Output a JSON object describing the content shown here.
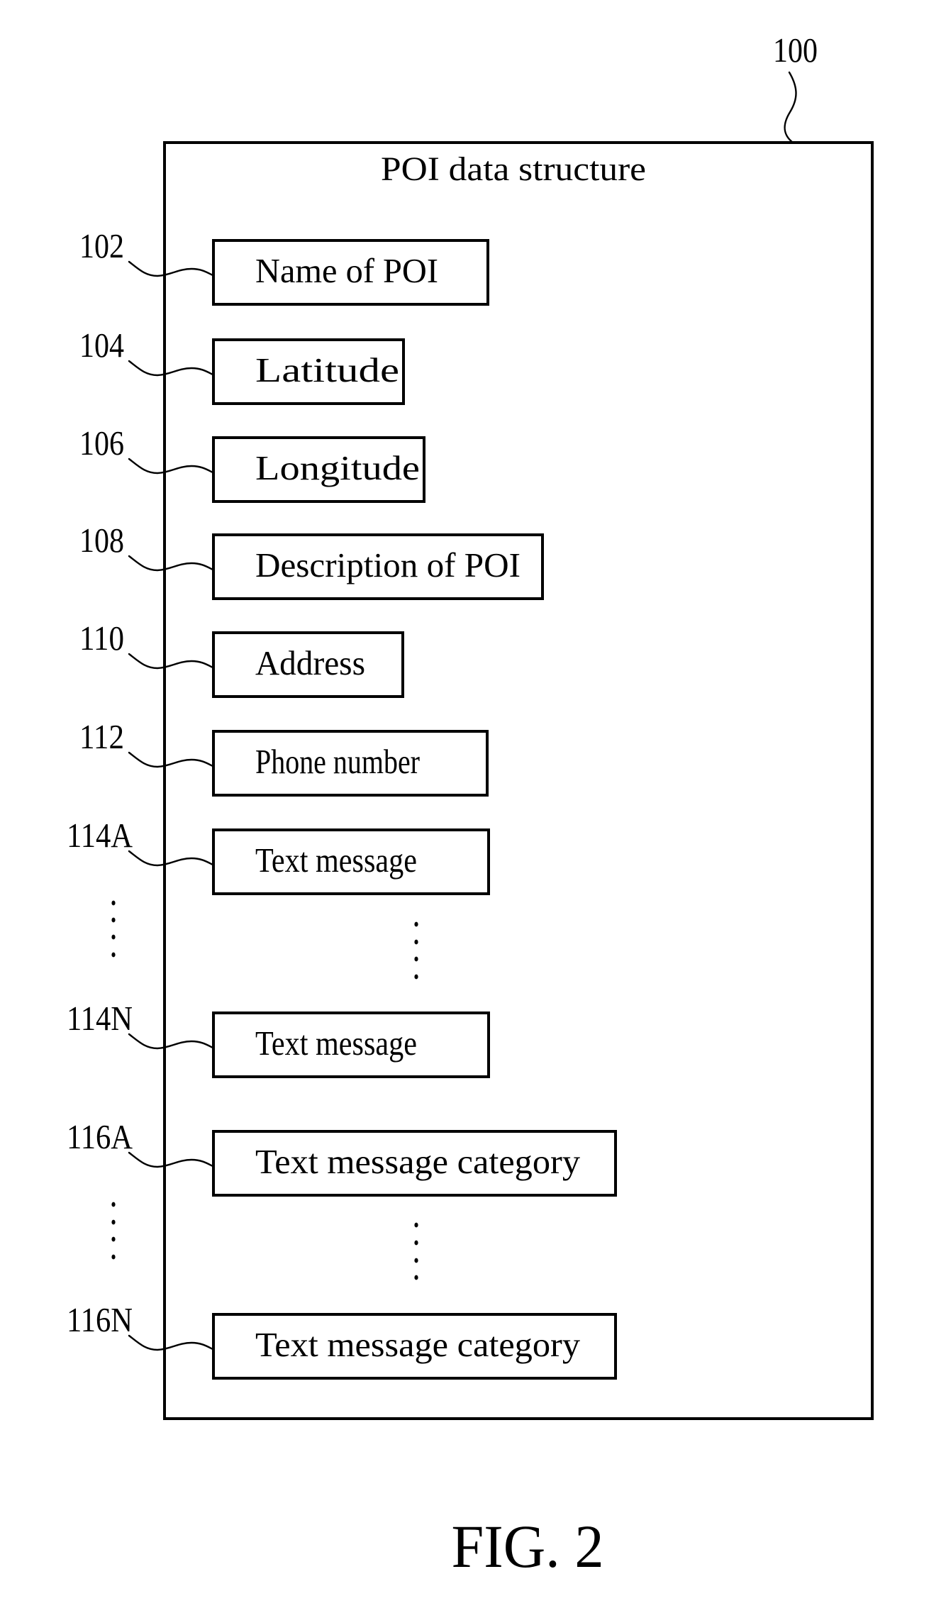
{
  "figure": {
    "caption": "FIG. 2",
    "container": {
      "ref": "100",
      "title": "POI data structure"
    },
    "fields": [
      {
        "ref": "102",
        "label": "Name of POI"
      },
      {
        "ref": "104",
        "label": "Latitude"
      },
      {
        "ref": "106",
        "label": "Longitude"
      },
      {
        "ref": "108",
        "label": "Description of POI"
      },
      {
        "ref": "110",
        "label": "Address"
      },
      {
        "ref": "112",
        "label": "Phone number"
      },
      {
        "ref": "114A",
        "label": "Text message"
      },
      {
        "ref": "114N",
        "label": "Text message"
      },
      {
        "ref": "116A",
        "label": "Text message category"
      },
      {
        "ref": "116N",
        "label": "Text message category"
      }
    ],
    "ellipses": [
      {
        "between": [
          "114A",
          "114N"
        ],
        "symbol": "vertical-dots"
      },
      {
        "between": [
          "116A",
          "116N"
        ],
        "symbol": "vertical-dots"
      }
    ]
  }
}
